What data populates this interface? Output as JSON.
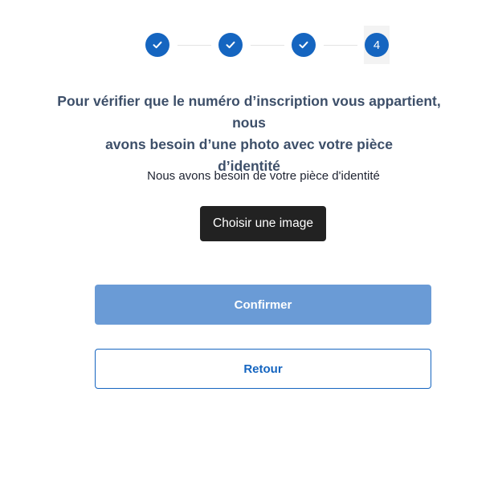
{
  "stepper": {
    "steps": [
      {
        "state": "completed",
        "icon": "check-icon"
      },
      {
        "state": "completed",
        "icon": "check-icon"
      },
      {
        "state": "completed",
        "icon": "check-icon"
      },
      {
        "state": "current",
        "label": "4"
      }
    ]
  },
  "headline": {
    "line1": "Pour vérifier que le numéro d’inscription vous appartient, nous",
    "line2": "avons besoin d’une photo avec votre pièce",
    "line3": "d’identité"
  },
  "subtitle": "Nous avons besoin de votre pièce d'identité",
  "buttons": {
    "choose_image": "Choisir une image",
    "confirm": "Confirmer",
    "back": "Retour"
  },
  "colors": {
    "primary": "#1565c0",
    "confirm_disabled": "#6a9bd6",
    "dark_button": "#222222",
    "headline_text": "#3d4f69"
  }
}
